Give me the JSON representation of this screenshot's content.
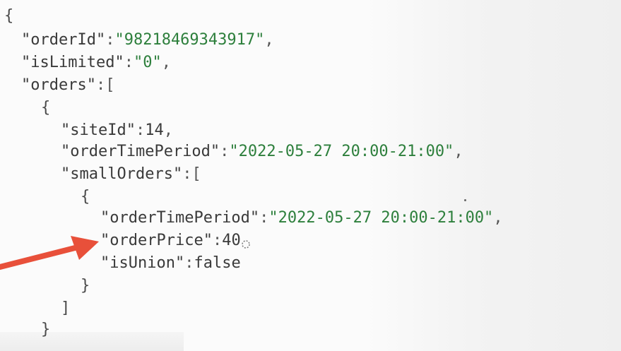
{
  "json_viewer": {
    "lines": [
      {
        "text": "{"
      },
      {
        "key": "\"orderId\"",
        "sep": ":",
        "value": "\"98218469343917\"",
        "end": ","
      },
      {
        "key": "\"isLimited\"",
        "sep": ":",
        "value": "\"0\"",
        "end": ","
      },
      {
        "key": "\"orders\"",
        "sep": ":",
        "value": "[",
        "end": ""
      },
      {
        "text": "{"
      },
      {
        "key": "\"siteId\"",
        "sep": ":",
        "value": "14",
        "end": ","
      },
      {
        "key": "\"orderTimePeriod\"",
        "sep": ":",
        "value": "\"2022-05-27 20:00-21:00\"",
        "end": ","
      },
      {
        "key": "\"smallOrders\"",
        "sep": ":",
        "value": "[",
        "end": ""
      },
      {
        "text": "{"
      },
      {
        "key": "\"orderTimePeriod\"",
        "sep": ":",
        "value": "\"2022-05-27 20:00-21:00\"",
        "end": ","
      },
      {
        "key": "\"orderPrice\"",
        "sep": ":",
        "value": "40",
        "end": ""
      },
      {
        "key": "\"isUnion\"",
        "sep": ":",
        "value": "false",
        "end": ""
      },
      {
        "text": "}"
      },
      {
        "text": "]"
      },
      {
        "text": "}"
      }
    ]
  },
  "annotation": {
    "arrow_color": "#e8503a",
    "points_to": "orderPrice"
  },
  "icons": {
    "cursor": "mouse-cursor-icon",
    "arrow": "red-arrow-icon"
  }
}
